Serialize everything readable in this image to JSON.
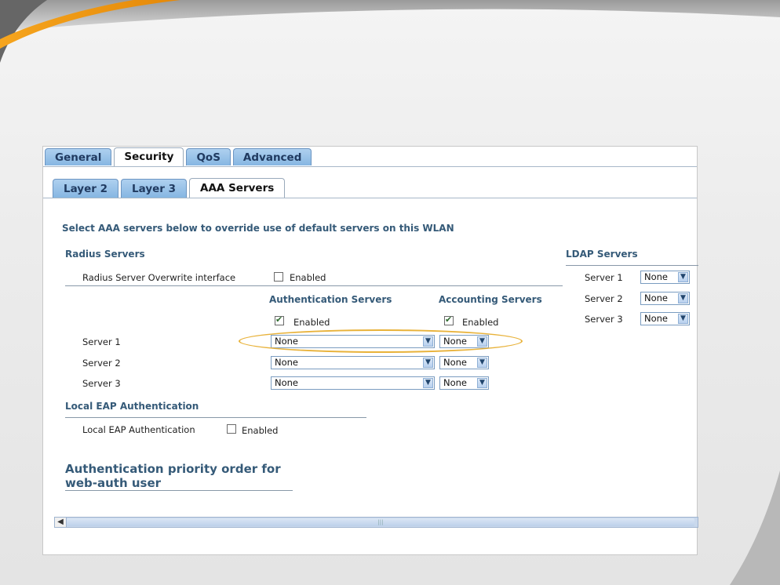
{
  "tabs": [
    "General",
    "Security",
    "QoS",
    "Advanced"
  ],
  "active_tab": "Security",
  "subtabs": [
    "Layer 2",
    "Layer 3",
    "AAA Servers"
  ],
  "active_subtab": "AAA Servers",
  "intro": "Select AAA servers below to override use of default servers on this WLAN",
  "radius": {
    "heading": "Radius Servers",
    "overwrite_label": "Radius Server Overwrite interface",
    "overwrite_checkbox_label": "Enabled",
    "overwrite_checked": false,
    "auth_header": "Authentication Servers",
    "acct_header": "Accounting Servers",
    "auth_enabled_label": "Enabled",
    "auth_enabled_checked": true,
    "acct_enabled_label": "Enabled",
    "acct_enabled_checked": true,
    "servers": [
      {
        "label": "Server 1",
        "auth": "None",
        "acct": "None"
      },
      {
        "label": "Server 2",
        "auth": "None",
        "acct": "None"
      },
      {
        "label": "Server 3",
        "auth": "None",
        "acct": "None"
      }
    ]
  },
  "ldap": {
    "heading": "LDAP Servers",
    "servers": [
      {
        "label": "Server 1",
        "value": "None"
      },
      {
        "label": "Server 2",
        "value": "None"
      },
      {
        "label": "Server 3",
        "value": "None"
      }
    ]
  },
  "local_eap": {
    "heading": "Local EAP Authentication",
    "label": "Local EAP Authentication",
    "checkbox_label": "Enabled",
    "checked": false
  },
  "priority": {
    "heading_line1": "Authentication priority order for",
    "heading_line2": "web-auth user"
  },
  "icons": {
    "dropdown": "chevron-down-icon",
    "checkbox": "checkbox-icon",
    "scroll_left": "scroll-left-icon"
  },
  "colors": {
    "highlight_ellipse": "#e8b23a",
    "tab_inactive": "#9cc4ea",
    "heading": "#355a78",
    "swoosh": "#f3a21b"
  }
}
